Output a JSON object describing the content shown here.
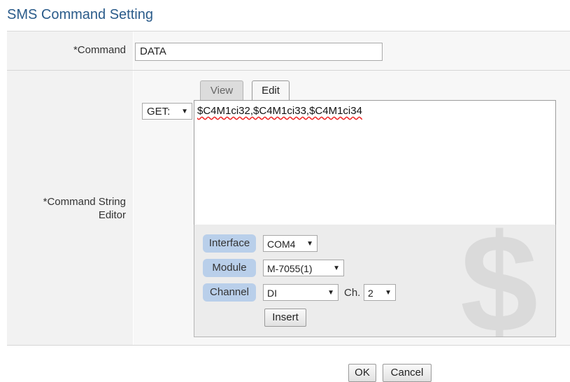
{
  "page": {
    "title": "SMS Command Setting"
  },
  "command": {
    "label": "*Command",
    "value": "DATA"
  },
  "editor": {
    "label": "*Command String\nEditor",
    "tabs": [
      {
        "label": "View"
      },
      {
        "label": "Edit"
      }
    ],
    "method": "GET:",
    "text": "$C4M1ci32,$C4M1ci33,$C4M1ci34",
    "watermark_icon": "dollar-icon"
  },
  "insert_panel": {
    "interface_label": "Interface",
    "interface_value": "COM4",
    "module_label": "Module",
    "module_value": "M-7055(1)",
    "channel_label": "Channel",
    "channel_value": "DI",
    "ch_label": "Ch.",
    "ch_value": "2",
    "insert_label": "Insert"
  },
  "footer": {
    "ok_label": "OK",
    "cancel_label": "Cancel"
  }
}
